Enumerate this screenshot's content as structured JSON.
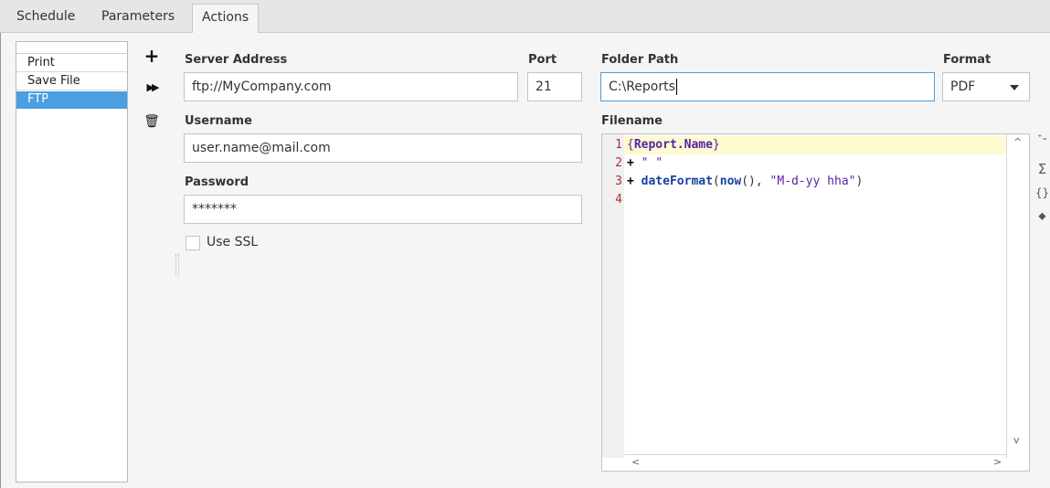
{
  "tabs": [
    {
      "label": "Schedule"
    },
    {
      "label": "Parameters"
    },
    {
      "label": "Actions"
    }
  ],
  "actions_list": {
    "items": [
      {
        "label": "Print"
      },
      {
        "label": "Save File"
      },
      {
        "label": "FTP"
      }
    ],
    "selected": "FTP"
  },
  "toolbar": {
    "add_symbol": "+",
    "run_symbol": "▶▶",
    "delete_symbol": "🗑"
  },
  "form": {
    "server_address_label": "Server Address",
    "server_address_value": "ftp://MyCompany.com",
    "port_label": "Port",
    "port_value": "21",
    "username_label": "Username",
    "username_value": "user.name@mail.com",
    "password_label": "Password",
    "password_value": "*******",
    "use_ssl_label": "Use SSL",
    "use_ssl_checked": false,
    "folder_path_label": "Folder Path",
    "folder_path_value": "C:\\Reports",
    "format_label": "Format",
    "format_value": "PDF",
    "filename_label": "Filename"
  },
  "editor": {
    "line_numbers": [
      "1",
      "2",
      "3",
      "4"
    ],
    "line1_open": "{",
    "line1_key": "Report.Name",
    "line1_close": "}",
    "line2_op": "+",
    "line2_str": " \" \"",
    "line3_op": "+",
    "line3_fn": " dateFormat",
    "line3_paren1": "(",
    "line3_fn2": "now",
    "line3_mid": "(), ",
    "line3_str": "\"M-d-yy hha\"",
    "line3_end": ")",
    "scroll_up": "^",
    "scroll_down": "v",
    "scroll_left": "<",
    "scroll_right": ">"
  },
  "side_icons": {
    "insert_property": "⁺₌",
    "functions": "Σ",
    "braces": "{}",
    "tag": "⬥"
  }
}
